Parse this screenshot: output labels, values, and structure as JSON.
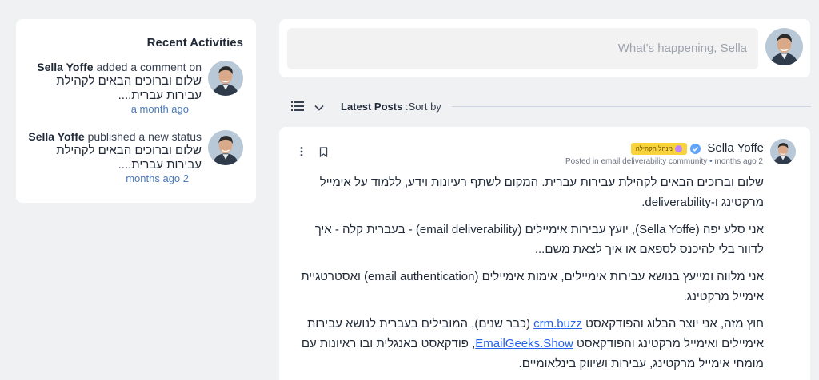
{
  "recent": {
    "title": "Recent Activities",
    "items": [
      {
        "user": "Sella Yoffe",
        "action": "added a comment on",
        "text": "שלום וברוכים הבאים לקהילת עבירות עברית....",
        "time": "a month ago"
      },
      {
        "user": "Sella Yoffe",
        "action": "published a new status",
        "text": "שלום וברוכים הבאים לקהילת עבירות עברית....",
        "time": "months ago 2"
      }
    ]
  },
  "composer": {
    "placeholder": "What's happening, Sella"
  },
  "sortbar": {
    "latest": "Latest Posts",
    "sort_by": ":Sort by"
  },
  "post": {
    "author": "Sella Yoffe",
    "badge": "מנהל הקהילה",
    "meta_posted": "Posted in email deliverability community",
    "meta_sep": "•",
    "meta_time": "months ago 2",
    "p1": "שלום וברוכים הבאים לקהילת עבירות עברית. המקום לשתף רעיונות וידע, ללמוד על אימייל מרקטינג ו-deliverability.",
    "p2": "אני סלע יפה (Sella Yoffe), יועץ עבירות אימיילים (email deliverability) - בעברית קלה - איך לדוור בלי להיכנס לספאם או איך לצאת משם...",
    "p3": "אני מלווה ומייעץ בנושא עבירות אימיילים, אימות אימיילים (email authentication) ואסטרטגיית אימייל מרקטינג.",
    "p4_a": "חוץ מזה, אני יוצר הבלוג והפודקאסט ",
    "p4_link1": "crm.buzz",
    "p4_b": " (כבר שנים), המובילים בעברית לנושא עבירות אימיילים ואימייל מרקטינג והפודקאסט ",
    "p4_link2": "EmailGeeks.Show",
    "p4_c": ", פודקאסט באנגלית ובו ראיונות עם מומחי אימייל מרקטינג, עבירות ושיווק בינלאומיים."
  },
  "colors": {
    "background": "#f0f1f3",
    "accent_blue": "#4a7ab9",
    "badge_yellow": "#f8d33b",
    "link": "#2563eb"
  },
  "icons": [
    "list-icon",
    "chevron-down-icon",
    "verified-icon",
    "kebab-icon",
    "bookmark-icon"
  ]
}
